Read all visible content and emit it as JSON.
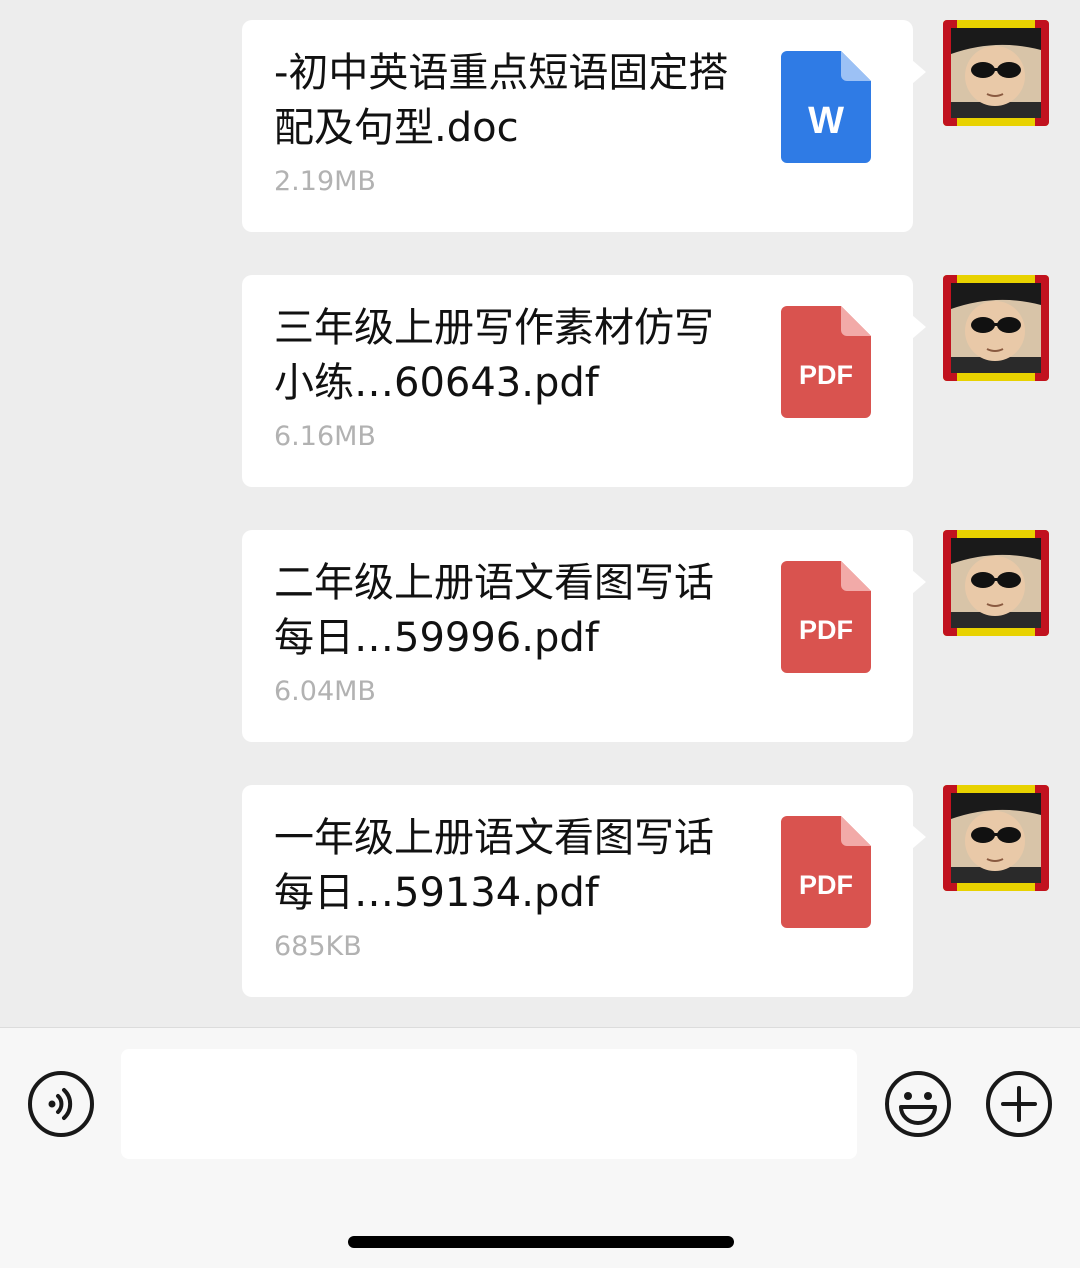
{
  "messages": [
    {
      "name": "-初中英语重点短语固定搭配及句型.doc",
      "size": "2.19MB",
      "icon": "word-doc-icon",
      "badge": "W",
      "color": "#2f7be5"
    },
    {
      "name": "三年级上册写作素材仿写小练…60643.pdf",
      "size": "6.16MB",
      "icon": "pdf-icon",
      "badge": "PDF",
      "color": "#d9534f"
    },
    {
      "name": "二年级上册语文看图写话每日…59996.pdf",
      "size": "6.04MB",
      "icon": "pdf-icon",
      "badge": "PDF",
      "color": "#d9534f"
    },
    {
      "name": "一年级上册语文看图写话每日…59134.pdf",
      "size": "685KB",
      "icon": "pdf-icon",
      "badge": "PDF",
      "color": "#d9534f"
    }
  ],
  "input_bar": {
    "text_value": "",
    "voice_icon": "voice-icon",
    "emoji_icon": "emoji-icon",
    "plus_icon": "plus-icon"
  }
}
